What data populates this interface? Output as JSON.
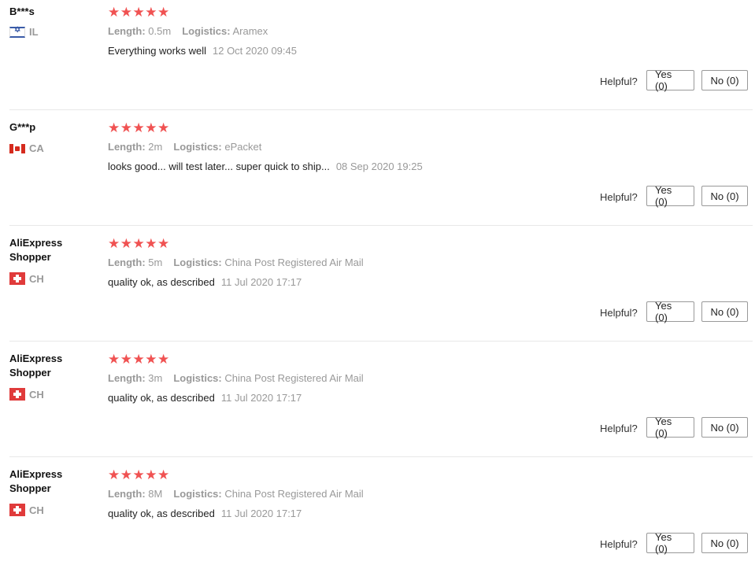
{
  "helpful_label": "Helpful?",
  "star_glyphs": "★★★★★",
  "length_label": "Length:",
  "logistics_label": "Logistics:",
  "reviews": [
    {
      "user": "B***s",
      "country": "IL",
      "flag": "il",
      "rating": 5,
      "length": "0.5m",
      "logistics": "Aramex",
      "comment": "Everything works well",
      "date": "12 Oct 2020 09:45",
      "yes": "Yes (0)",
      "no": "No (0)"
    },
    {
      "user": "G***p",
      "country": "CA",
      "flag": "ca",
      "rating": 5,
      "length": "2m",
      "logistics": "ePacket",
      "comment": "looks good... will test later... super quick to ship...",
      "date": "08 Sep 2020 19:25",
      "yes": "Yes (0)",
      "no": "No (0)"
    },
    {
      "user": "AliExpress Shopper",
      "country": "CH",
      "flag": "ch",
      "rating": 5,
      "length": "5m",
      "logistics": "China Post Registered Air Mail",
      "comment": "quality ok, as described",
      "date": "11 Jul 2020 17:17",
      "yes": "Yes (0)",
      "no": "No (0)"
    },
    {
      "user": "AliExpress Shopper",
      "country": "CH",
      "flag": "ch",
      "rating": 5,
      "length": "3m",
      "logistics": "China Post Registered Air Mail",
      "comment": "quality ok, as described",
      "date": "11 Jul 2020 17:17",
      "yes": "Yes (0)",
      "no": "No (0)"
    },
    {
      "user": "AliExpress Shopper",
      "country": "CH",
      "flag": "ch",
      "rating": 5,
      "length": "8M",
      "logistics": "China Post Registered Air Mail",
      "comment": "quality ok, as described",
      "date": "11 Jul 2020 17:17",
      "yes": "Yes (0)",
      "no": "No (0)"
    }
  ],
  "colors": {
    "star": "#f05252",
    "muted": "#999999",
    "text": "#222222"
  }
}
